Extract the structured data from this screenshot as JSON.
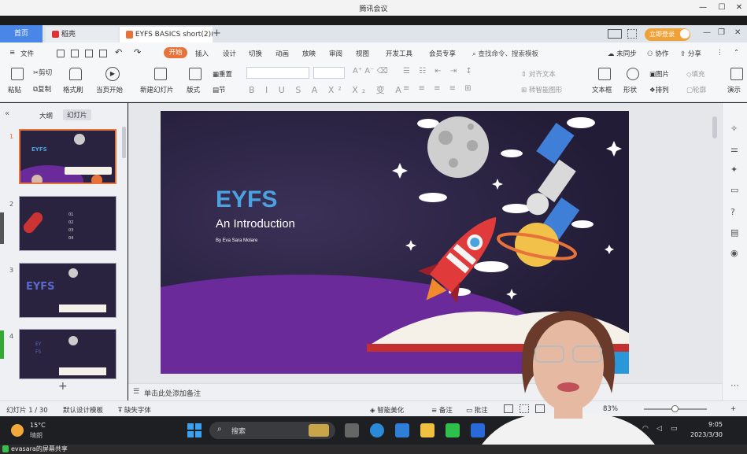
{
  "meeting": {
    "title": "腾讯会议"
  },
  "tabs": {
    "home": "首页",
    "daoke": "稻壳",
    "doc": "EYFS BASICS short(2)(2",
    "add": "+"
  },
  "header_right": {
    "login": "立即登录"
  },
  "menu": {
    "file": "文件",
    "items": [
      "开始",
      "插入",
      "设计",
      "切换",
      "动画",
      "放映",
      "审阅",
      "视图",
      "开发工具",
      "会员专享"
    ],
    "search": "查找命令、搜索模板",
    "sync": "未同步",
    "collab": "协作",
    "share": "分享"
  },
  "ribbon": {
    "paste": "粘贴",
    "cut": "剪切",
    "copy": "复制",
    "format_painter": "格式刷",
    "play_from_current": "当页开始",
    "new_slide": "新建幻灯片",
    "layout": "版式",
    "section": "节",
    "reset": "重置",
    "text_direction": "对齐文本",
    "smart_art": "转智能图形",
    "textbox": "文本框",
    "shape": "形状",
    "arrange": "排列",
    "picture": "图片",
    "fill": "填充",
    "outline": "轮廓",
    "present": "演示"
  },
  "left_pane": {
    "tab_outline": "大纲",
    "tab_slides": "幻灯片",
    "add": "+",
    "slide_numbers": [
      "1",
      "2",
      "3",
      "4"
    ]
  },
  "thumb2": {
    "items": [
      "01",
      "02",
      "03",
      "04"
    ]
  },
  "thumb3": {
    "title": "EYFS"
  },
  "thumb4": {
    "title": "EYFS"
  },
  "slide": {
    "title": "EYFS",
    "subtitle": "An Introduction",
    "author": "By Eva Sara Molare"
  },
  "notes": {
    "placeholder": "单击此处添加备注"
  },
  "status": {
    "slide_count": "幻灯片 1 / 30",
    "template": "默认设计模板",
    "missing_font": "缺失字体",
    "smart_beautify": "智能美化",
    "notes": "备注",
    "comments": "批注",
    "zoom": "83%"
  },
  "taskbar": {
    "weather_temp": "15°C",
    "weather_desc": "晴朗",
    "search": "搜索",
    "time": "9:05",
    "date": "2023/3/30"
  },
  "share_bar": {
    "text": "evasara的屏幕共享"
  },
  "colors": {
    "accent": "#e8733a",
    "tab_blue": "#4a86e8",
    "slide_bg": "#2a2340",
    "purple": "#6a2a9a",
    "title_blue": "#4aa3e0"
  }
}
